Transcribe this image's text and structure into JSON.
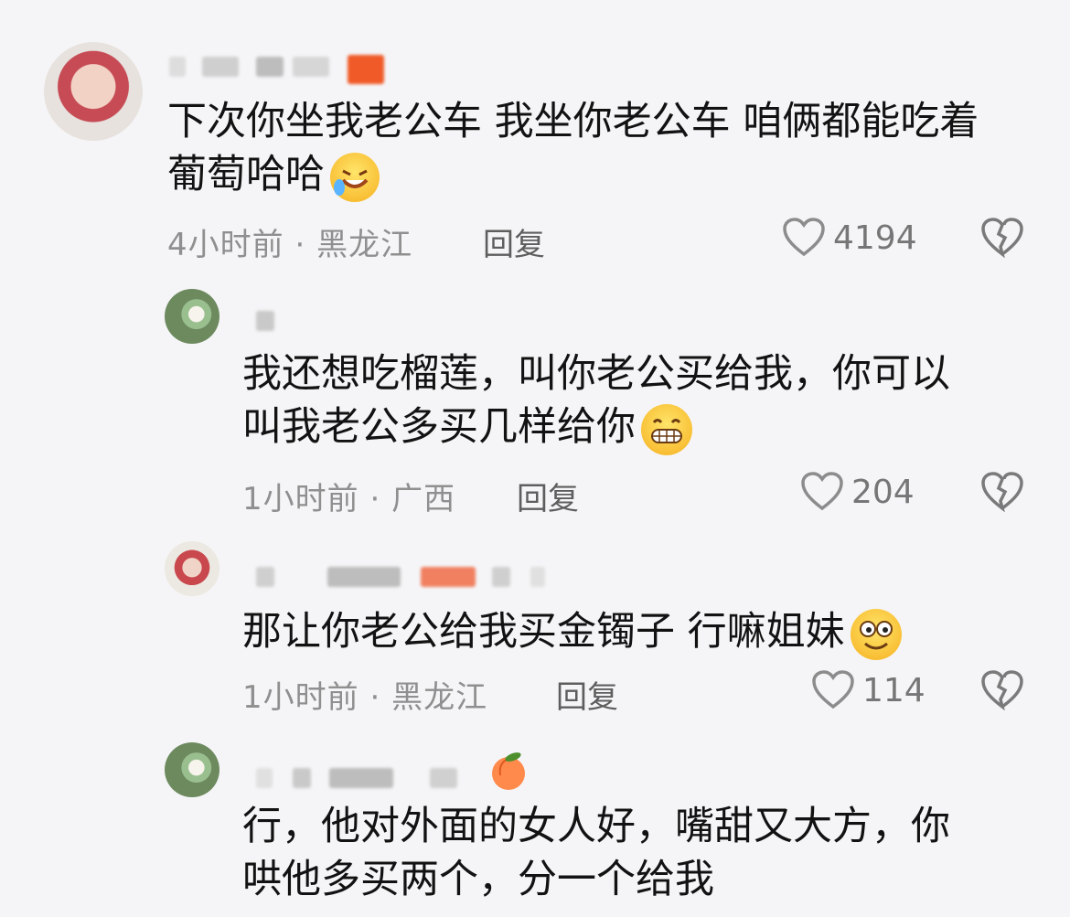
{
  "comments": [
    {
      "level": "top",
      "text_lines": [
        "下次你坐我老公车 我坐你老公车 咱俩都能吃着",
        "葡萄哈哈"
      ],
      "emoji": "rofl-face",
      "time": "4小时前",
      "separator": "·",
      "location": "黑龙江",
      "reply_label": "回复",
      "likes": "4194"
    },
    {
      "level": "reply",
      "text_lines": [
        "我还想吃榴莲，叫你老公买给我，你可以",
        "叫我老公多买几样给你"
      ],
      "emoji": "grin-face",
      "time": "1小时前",
      "separator": "·",
      "location": "广西",
      "reply_label": "回复",
      "likes": "204"
    },
    {
      "level": "reply",
      "text_lines": [
        "那让你老公给我买金镯子 行嘛姐妹"
      ],
      "emoji": "goofy-face",
      "time": "1小时前",
      "separator": "·",
      "location": "黑龙江",
      "reply_label": "回复",
      "likes": "114"
    },
    {
      "level": "reply",
      "text_lines": [
        "行，他对外面的女人好，嘴甜又大方，你",
        "哄他多买两个，分一个给我"
      ],
      "name_emoji": "peach-emoji"
    }
  ],
  "colors": {
    "background": "#f5f5f7",
    "text": "#121212",
    "meta": "#8f8f8f",
    "badge": "#f05a28"
  }
}
